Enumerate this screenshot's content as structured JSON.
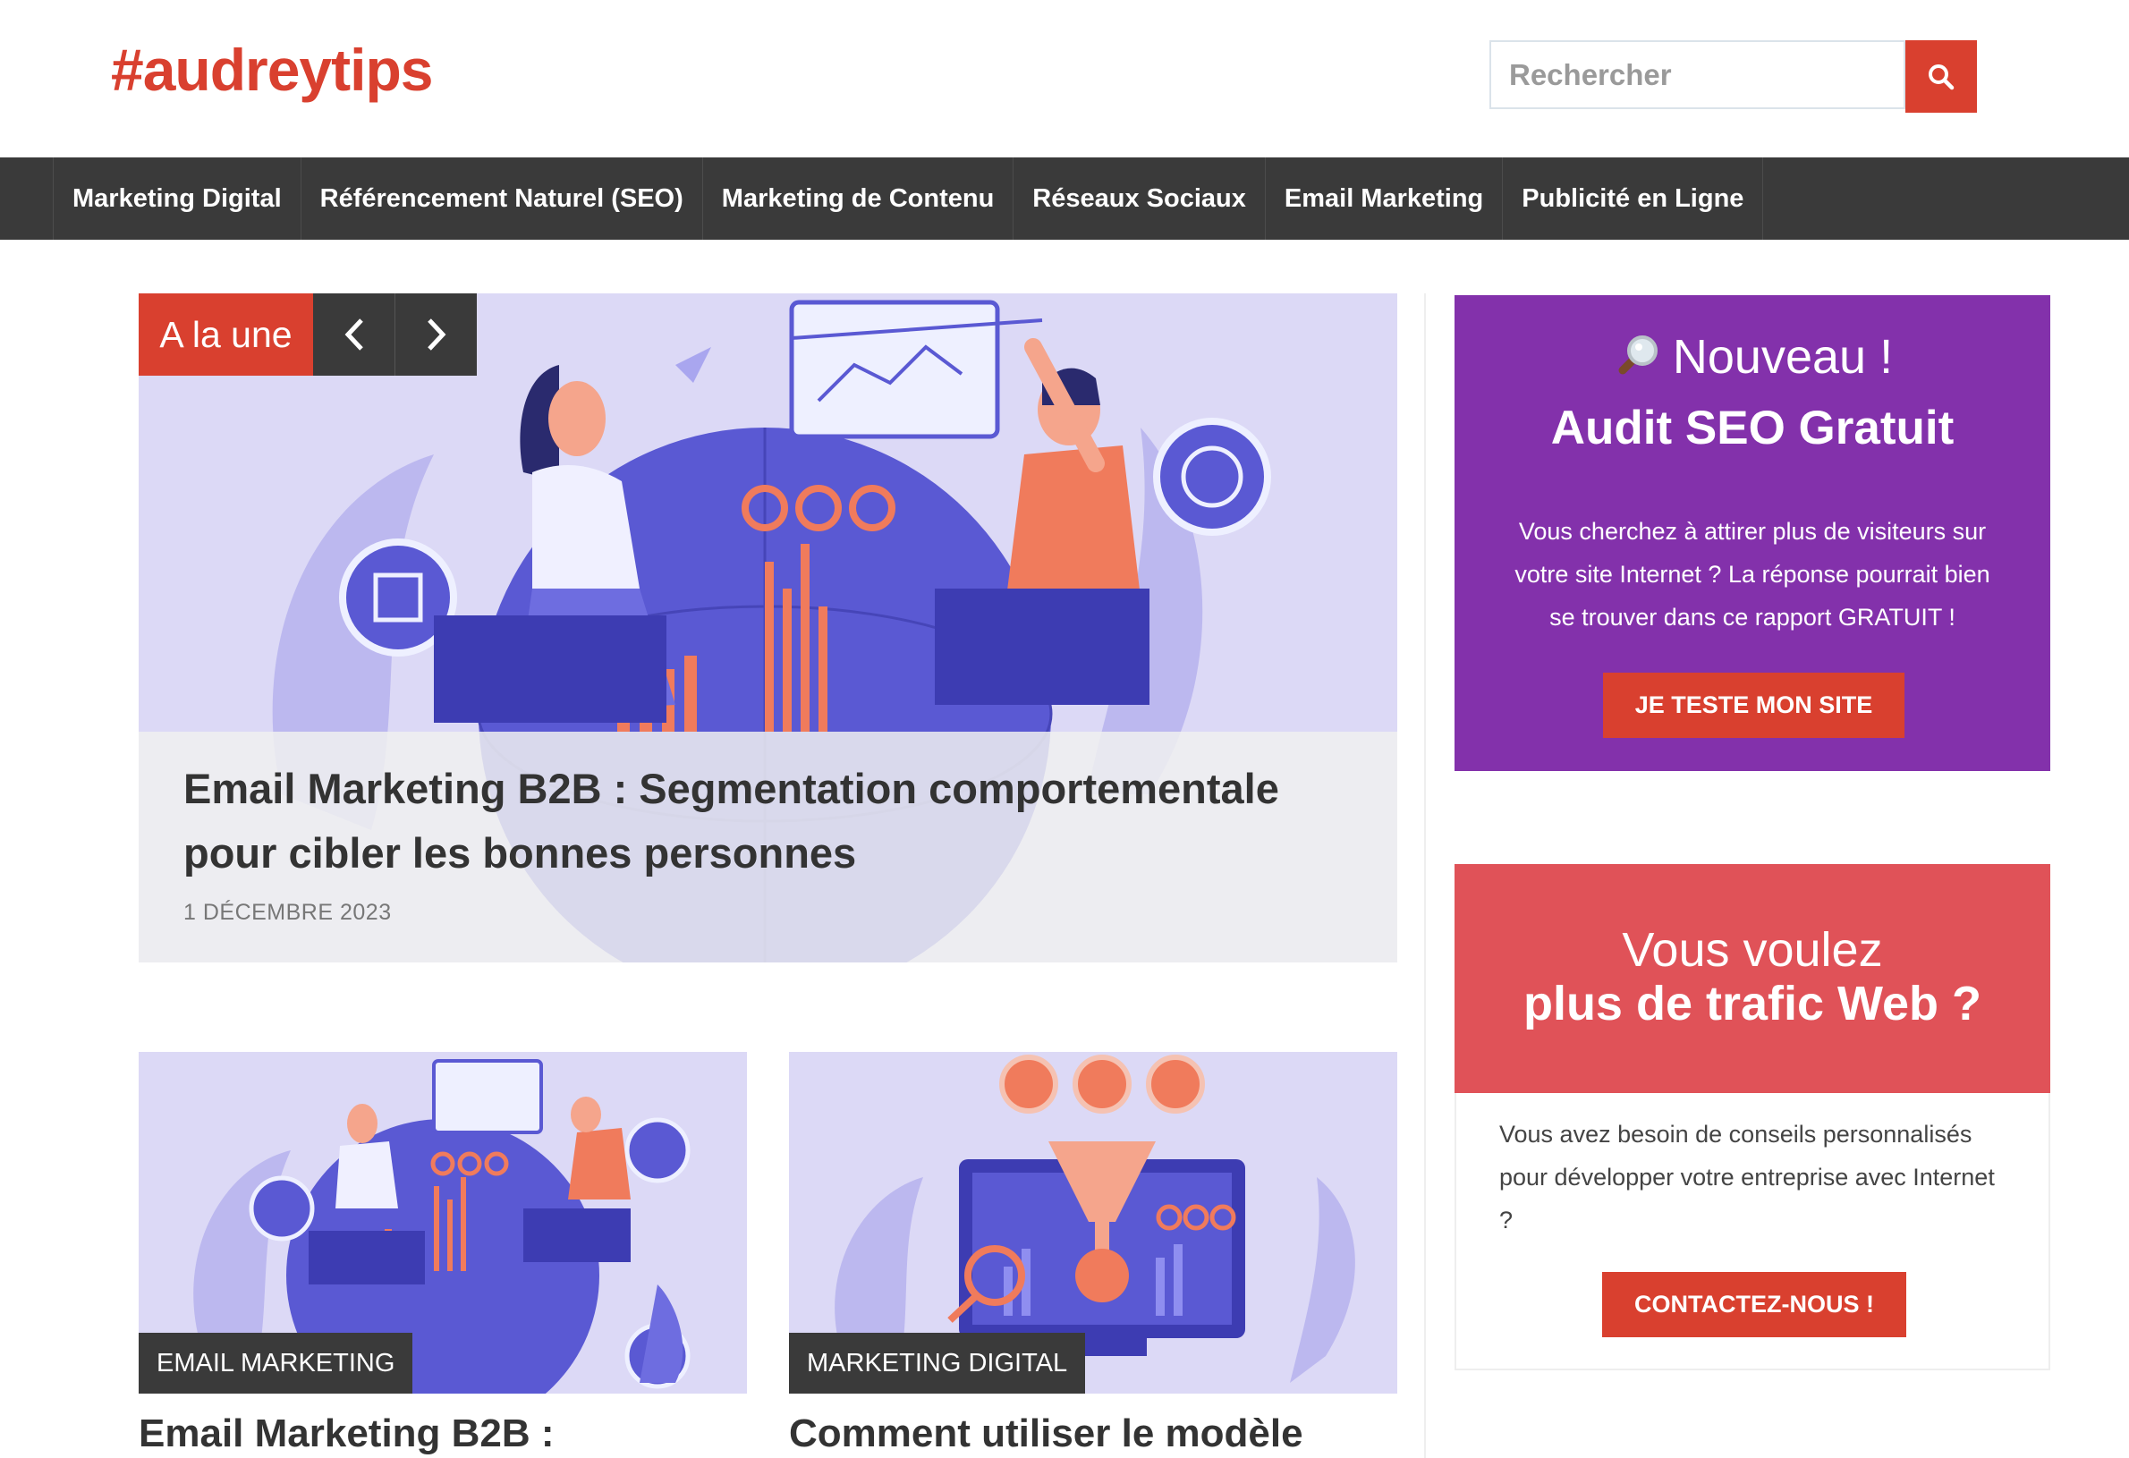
{
  "site": {
    "logo": "#audreytips"
  },
  "search": {
    "placeholder": "Rechercher"
  },
  "nav": {
    "items": [
      "Marketing Digital",
      "Référencement Naturel (SEO)",
      "Marketing de Contenu",
      "Réseaux Sociaux",
      "Email Marketing",
      "Publicité en Ligne"
    ]
  },
  "featured": {
    "badge": "A la une",
    "title": "Email Marketing B2B : Segmentation comportementale pour cibler les bonnes personnes",
    "date": "1 DÉCEMBRE 2023"
  },
  "cards": [
    {
      "category": "EMAIL MARKETING",
      "title": "Email Marketing B2B :"
    },
    {
      "category": "MARKETING DIGITAL",
      "title": "Comment utiliser le modèle"
    }
  ],
  "promo_audit": {
    "new": "Nouveau !",
    "title": "Audit SEO Gratuit",
    "text": "Vous cherchez à attirer plus de visiteurs sur votre site Internet ? La réponse pourrait bien se trouver dans ce rapport GRATUIT !",
    "button": "JE TESTE MON SITE"
  },
  "promo_contact": {
    "line1": "Vous voulez",
    "line2": "plus de trafic Web ?",
    "text": "Vous avez besoin de conseils personnalisés pour développer votre entreprise avec Internet ?",
    "button": "CONTACTEZ-NOUS !"
  },
  "colors": {
    "accent": "#d9402f",
    "nav_bg": "#3a3a3a",
    "promo_purple": "#8331ab",
    "promo_red": "#e05258"
  }
}
